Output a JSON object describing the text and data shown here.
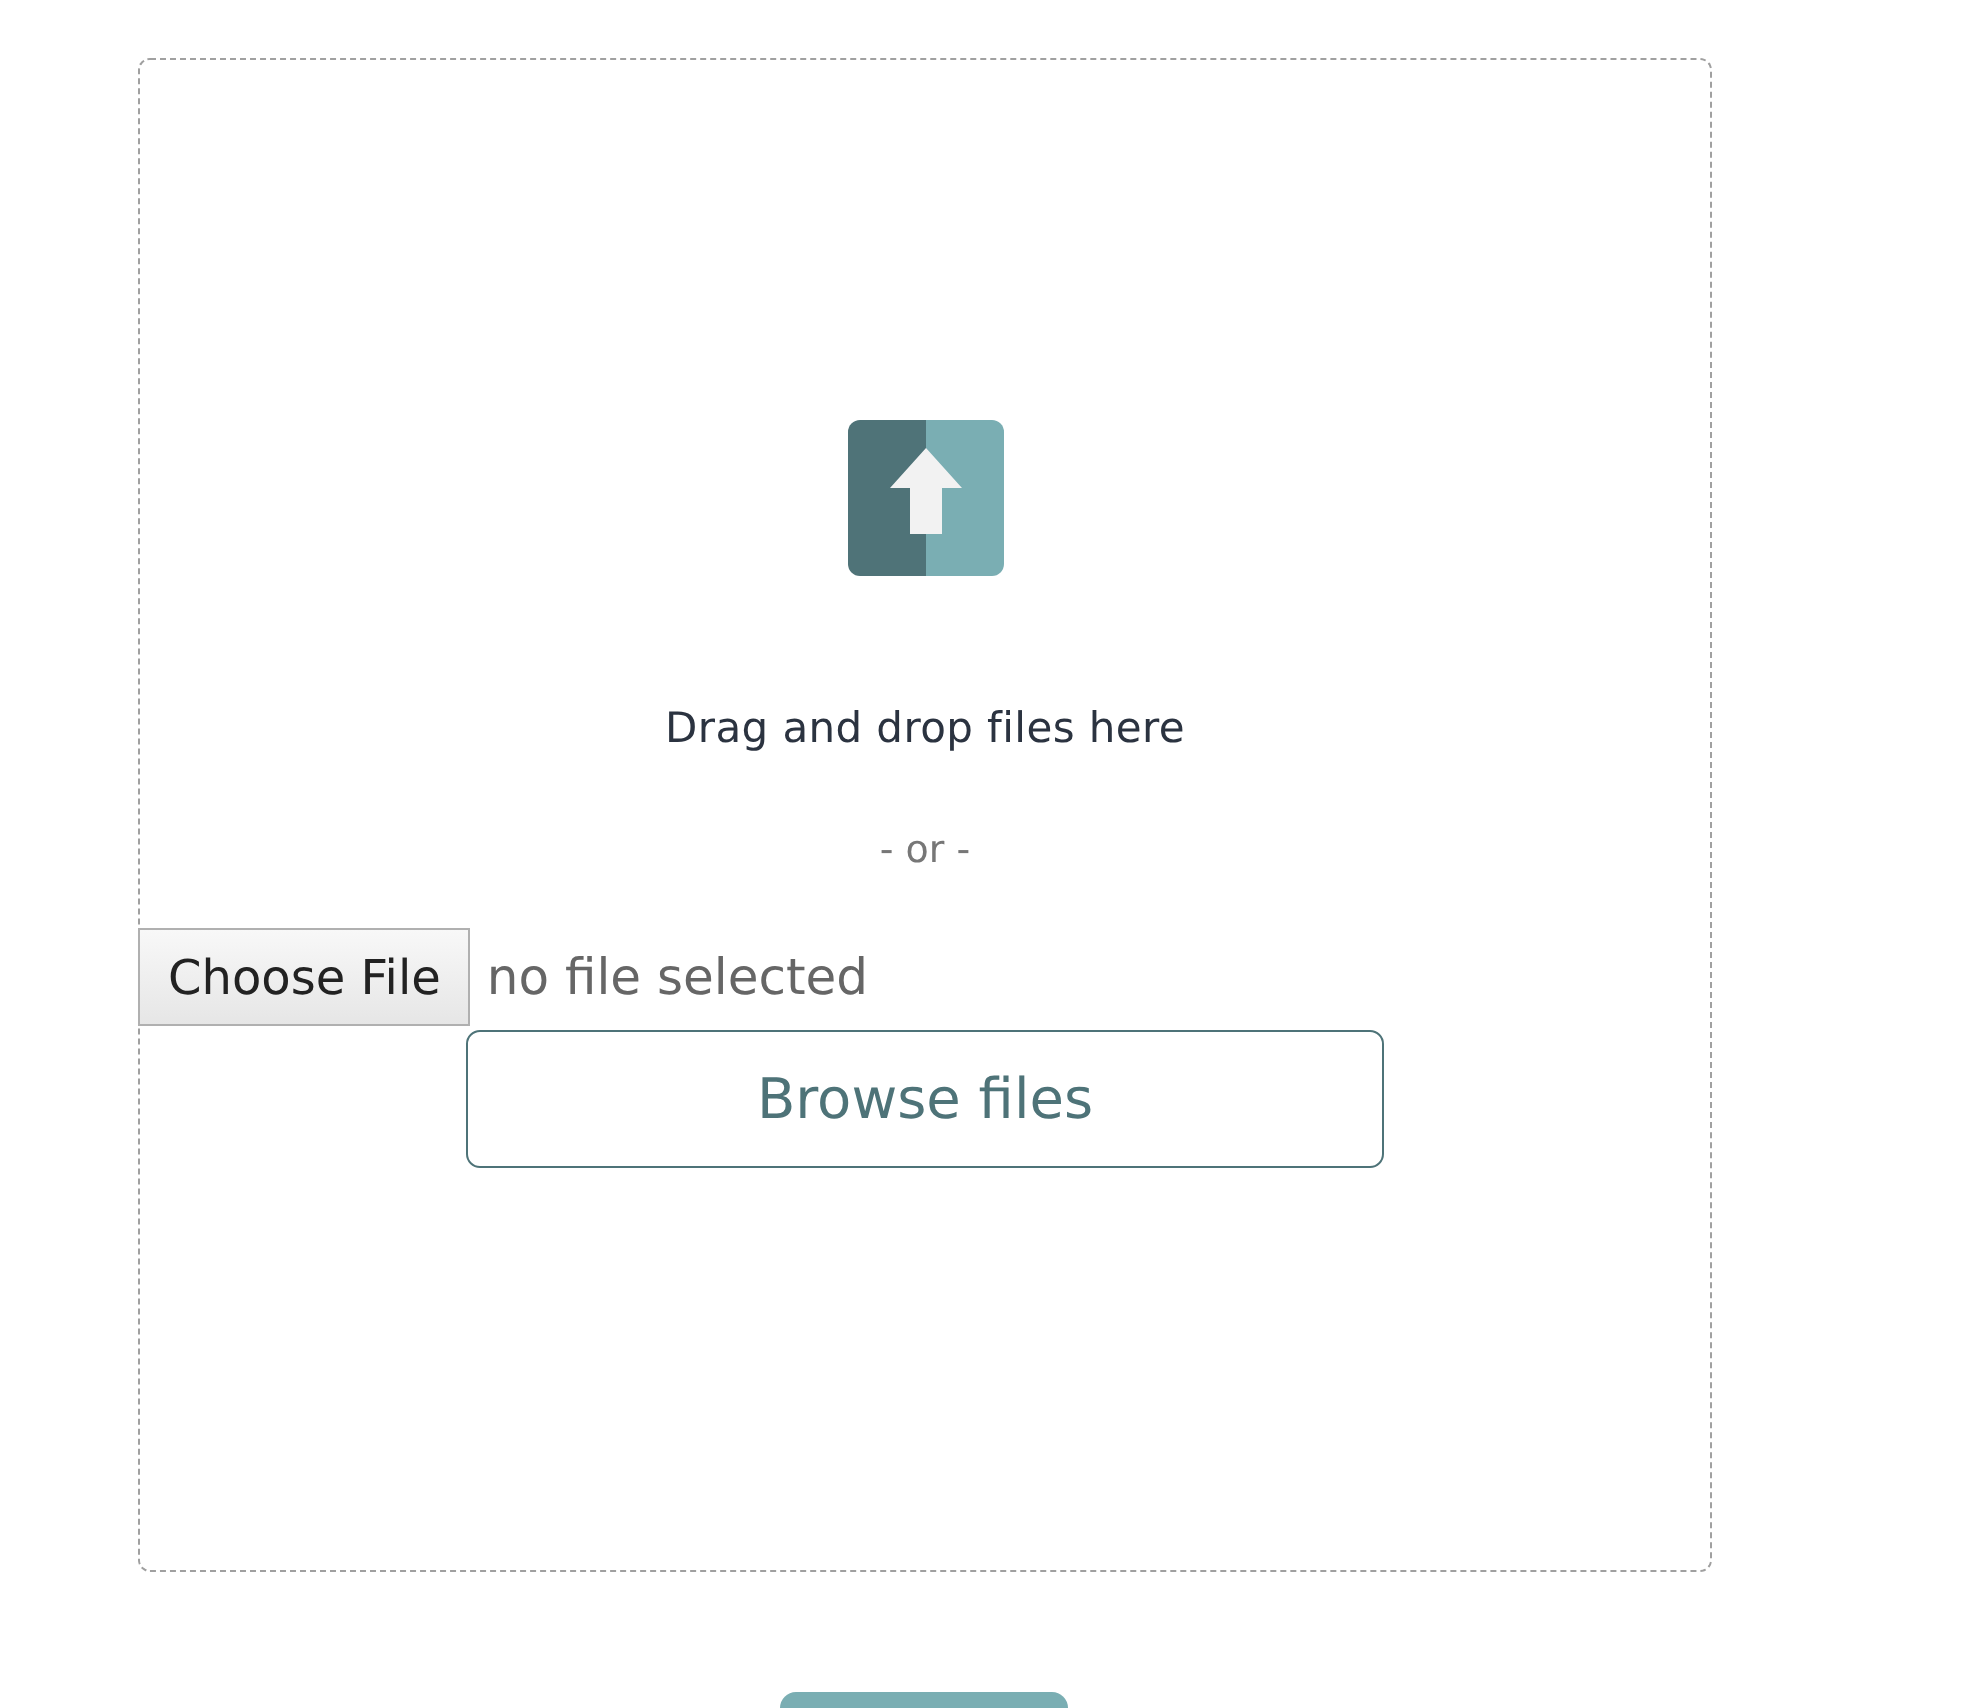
{
  "dropzone": {
    "prompt": "Drag and drop files here",
    "separator": "- or -",
    "file_input": {
      "button": "Choose File",
      "status": "no file selected"
    },
    "browse_button": {
      "label": "Browse files"
    }
  }
}
